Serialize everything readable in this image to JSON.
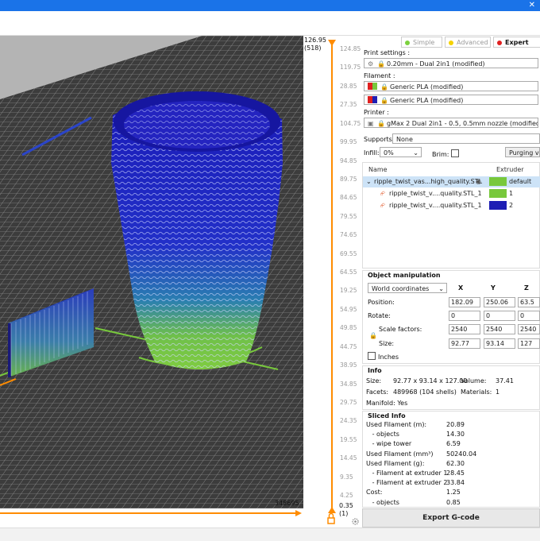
{
  "window": {
    "close_glyph": "✕"
  },
  "viewport": {
    "bottom_value": "348695",
    "colors": {
      "bed": "#3c3c3c",
      "grid": "#8e8e8e",
      "background": "#b4b4b4",
      "blue": "#1e1eb4",
      "green": "#78c83c",
      "orange": "#ff8c00"
    }
  },
  "layer_slider": {
    "top_value": "126.95",
    "top_layer": "(518)",
    "bottom_value": "0.35",
    "bottom_layer": "(1)",
    "ticks": [
      "124.85",
      "119.75",
      "28.85",
      "27.35",
      "104.75",
      "99.95",
      "94.85",
      "89.75",
      "84.65",
      "79.55",
      "74.65",
      "69.55",
      "64.55",
      "19.25",
      "54.95",
      "49.85",
      "44.75",
      "38.95",
      "34.85",
      "29.75",
      "24.35",
      "19.55",
      "14.45",
      "9.35",
      "4.25"
    ],
    "lock_icon": "lock-icon",
    "settings_icon": "gear-icon"
  },
  "mode": {
    "simple": "Simple",
    "advanced": "Advanced",
    "expert": "Expert"
  },
  "print_settings": {
    "label": "Print settings :",
    "value": "0.20mm - Dual 2in1 (modified)"
  },
  "filament": {
    "label": "Filament :",
    "items": [
      "Generic PLA (modified)",
      "Generic PLA (modified)"
    ]
  },
  "printer": {
    "label": "Printer :",
    "value": "gMax 2 Dual 2in1 - 0.5, 0.5mm nozzle (modified)"
  },
  "supports": {
    "label": "Supports:",
    "value": "None"
  },
  "infill": {
    "label": "Infill:",
    "value": "0%"
  },
  "brim": {
    "label": "Brim:"
  },
  "purging": {
    "label": "Purging vo"
  },
  "object_list": {
    "col_name": "Name",
    "col_extruder": "Extruder",
    "rows": [
      {
        "name": "ripple_twist_vas...high_quality.STL",
        "extruder": "default"
      },
      {
        "name": "ripple_twist_v....quality.STL_1",
        "extruder": "1"
      },
      {
        "name": "ripple_twist_v....quality.STL_1",
        "extruder": "2"
      }
    ]
  },
  "object_manipulation": {
    "title": "Object manipulation",
    "coords": "World coordinates",
    "x": "X",
    "y": "Y",
    "z": "Z",
    "position_label": "Position:",
    "position": [
      "182.09",
      "250.06",
      "63.5"
    ],
    "rotate_label": "Rotate:",
    "rotate": [
      "0",
      "0",
      "0"
    ],
    "scale_label": "Scale factors:",
    "scale": [
      "2540",
      "2540",
      "2540"
    ],
    "size_label": "Size:",
    "size": [
      "92.77",
      "93.14",
      "127"
    ],
    "inches_label": "Inches"
  },
  "info": {
    "title": "Info",
    "size_label": "Size:",
    "size": "92.77 x 93.14 x 127.00",
    "volume_label": "Volume:",
    "volume": "37.41",
    "facets_label": "Facets:",
    "facets": "489968 (104 shells)",
    "materials_label": "Materials:",
    "materials": "1",
    "manifold": "Manifold: Yes"
  },
  "sliced_info": {
    "title": "Sliced Info",
    "rows": [
      {
        "label": "Used Filament (m):",
        "value": "20.89"
      },
      {
        "label": "   - objects",
        "value": "14.30"
      },
      {
        "label": "   - wipe tower",
        "value": "6.59"
      },
      {
        "label": "Used Filament (mm³)",
        "value": "50240.04"
      },
      {
        "label": "Used Filament (g):",
        "value": "62.30"
      },
      {
        "label": "   - Filament at extruder 1",
        "value": "28.45"
      },
      {
        "label": "   - Filament at extruder 2",
        "value": "33.84"
      },
      {
        "label": "Cost:",
        "value": "1.25"
      },
      {
        "label": "   - objects",
        "value": "0.85"
      }
    ]
  },
  "export_button": "Export G-code"
}
